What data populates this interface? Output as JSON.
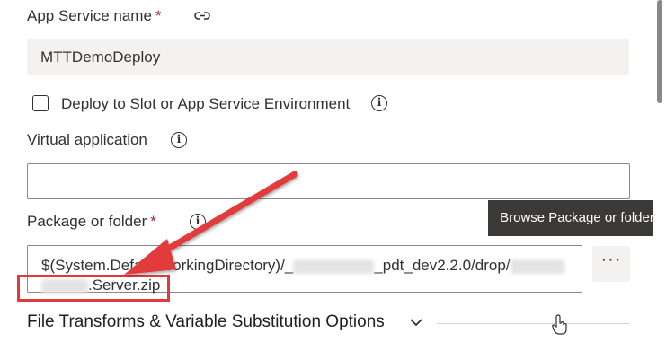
{
  "app_service": {
    "label": "App Service name",
    "required_mark": "*",
    "value": "MTTDemoDeploy",
    "link_icon": "link-icon"
  },
  "deploy_slot": {
    "label": "Deploy to Slot or App Service Environment",
    "checked": false,
    "info_icon": "info-icon"
  },
  "virtual_application": {
    "label": "Virtual application",
    "value": "",
    "info_icon": "info-icon"
  },
  "package": {
    "label": "Package or folder",
    "required_mark": "*",
    "value_part1": "$(System.DefaultWorkingDirectory)/_",
    "value_part2": "_pdt_dev2.2.0/drop/",
    "value_part3": ".Server.zip",
    "browse_label": "···",
    "tooltip": "Browse Package or folder",
    "info_icon": "info-icon"
  },
  "section": {
    "title": "File Transforms & Variable Substitution Options",
    "chevron_icon": "chevron-down-icon"
  },
  "annotation": {
    "arrow_color": "#e23a3a",
    "highlight_color": "#e23a3a"
  },
  "colors": {
    "required": "#a4262c",
    "tooltip_bg": "#3b3a39",
    "field_readonly_bg": "#f3f2f1",
    "border": "#8a8886"
  }
}
